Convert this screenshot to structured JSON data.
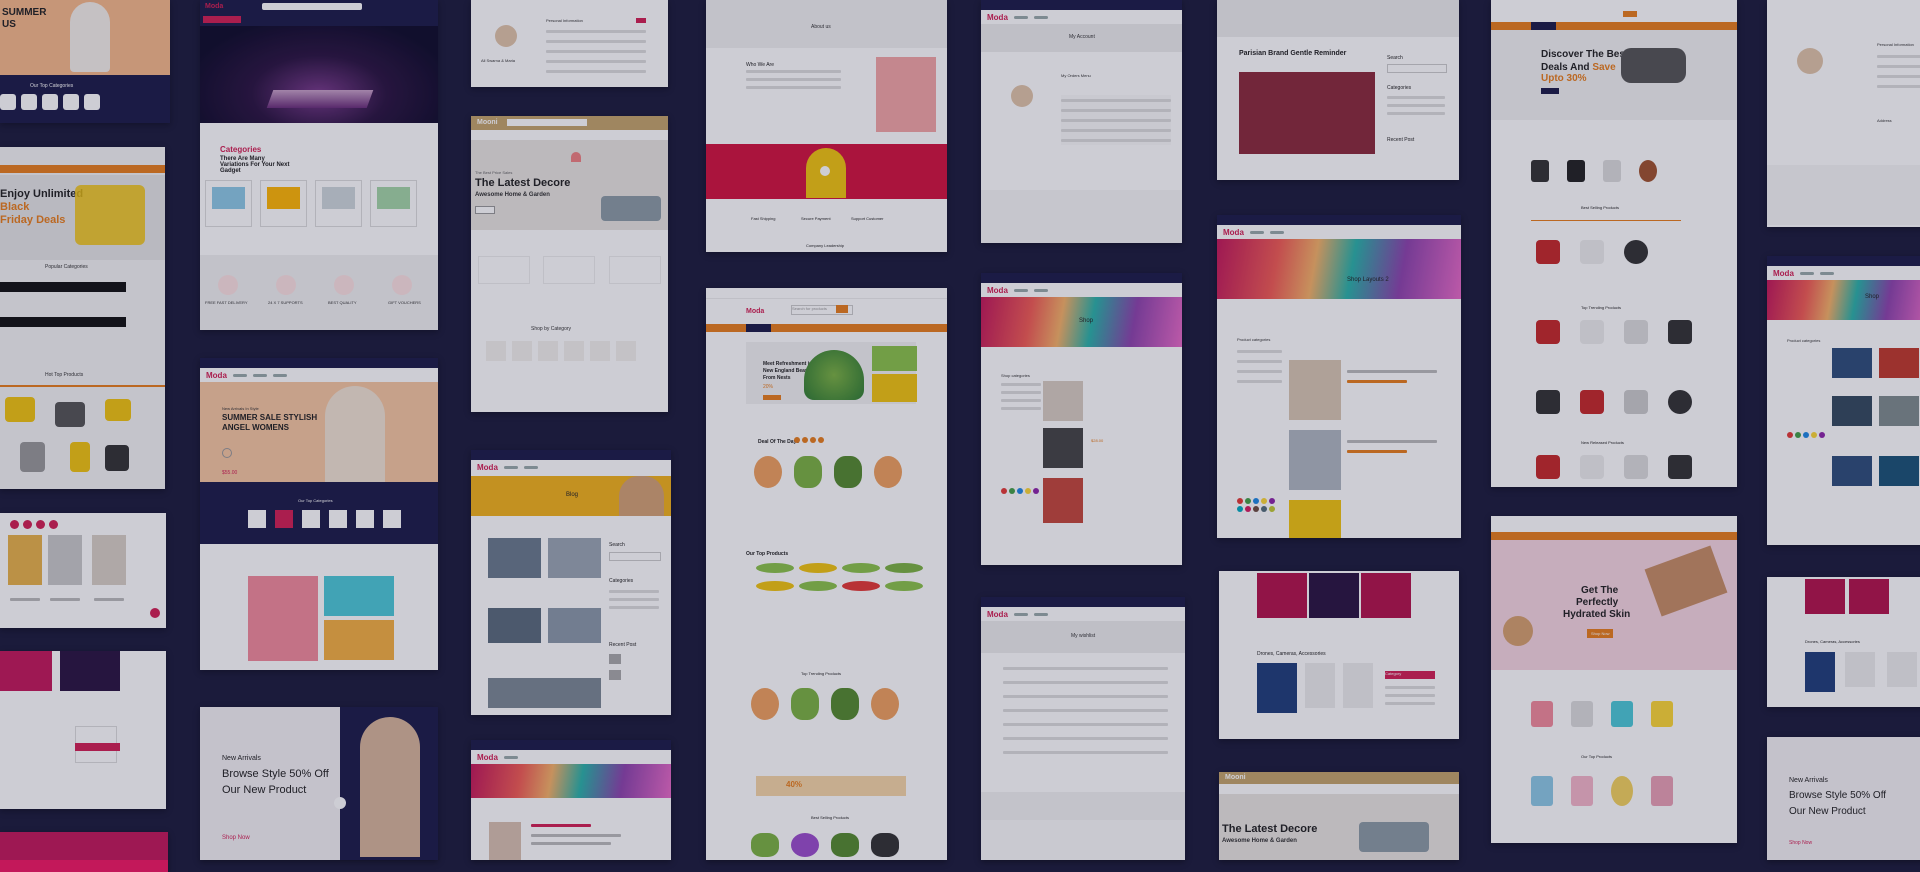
{
  "brand": "Moda",
  "cards": {
    "c1": {
      "title": "SUMMER",
      "sub": "US",
      "cat": "Our Top Categories"
    },
    "c2": {
      "promo_title": "Enjoy Unlimited",
      "promo_l2": "Black",
      "promo_l3": "Friday Deals",
      "section": "Popular Categories",
      "prod": "Hot Top Products"
    },
    "c3": {
      "cat_title": "Categories",
      "cat_sub": "There Are Many Variations For Your Next Gadget",
      "f1": "FREE FAST DELIVERY",
      "f2": "24 X 7 SUPPORTS",
      "f3": "BEST QUALITY",
      "f4": "GIFT VOUCHERS"
    },
    "c4": {
      "eyebrow": "New Arrivals In Style",
      "title_l1": "SUMMER SALE STYLISH",
      "title_l2": "ANGEL WOMENS",
      "cats": "Our Top Categories",
      "price": "$55.00"
    },
    "c5": {
      "new_arrivals": "New Arrivals",
      "title_l1": "Browse Style 50% Off",
      "title_l2": "Our New Product",
      "shop": "Shop Now"
    },
    "c6": {
      "panel_title": "Personal Information",
      "user": "All Swarna & Maria"
    },
    "c7": {
      "brand": "Mooni",
      "eyebrow": "The Best Price Sales",
      "title": "The Latest Decore",
      "sub": "Awesome Home & Garden",
      "shop": "Shop by Category"
    },
    "c8": {
      "page_title": "Blog",
      "search": "Search",
      "categories": "Categories",
      "recent": "Recent Post"
    },
    "c9": {
      "about": "About us",
      "who": "Who We Are",
      "f1": "Fast Shipping",
      "f2": "Secure Payment",
      "f3": "Support Customer",
      "team": "Company Leadership"
    },
    "c10": {
      "search_placeholder": "Search for products",
      "hero_l1": "Meet Refreshment in",
      "hero_l2": "New England Bean",
      "hero_l3": "From Nests",
      "discount": "20%",
      "deal": "Deal Of The Days",
      "top": "Our Top Products",
      "trending": "Top Trending Products",
      "banner_pct": "40%",
      "bestsellers": "Best Selling Products"
    },
    "c11": {
      "title": "My Account",
      "orders": "My Orders Menu"
    },
    "c12": {
      "title": "Shop",
      "categories": "Shop categories"
    },
    "c13": {
      "title": "My wishlist"
    },
    "c14": {
      "title": "Parisian Brand Gentle Reminder",
      "search": "Search",
      "categories": "Categories",
      "recent": "Recent Post"
    },
    "c15": {
      "title": "Shop Layouts 2",
      "cat": "Product categories"
    },
    "c16": {
      "section": "Drones, Cameras, Accessories",
      "cats": "Category"
    },
    "c17": {
      "brand": "Mooni",
      "title": "The Latest Decore",
      "sub": "Awesome Home & Garden"
    },
    "c18": {
      "title_l1": "Discover The Best",
      "title_l2a": "Deals And ",
      "title_l2b": "Save",
      "title_l3": "Upto 30%",
      "best": "Best Selling Products",
      "trending": "Top Trending Products",
      "newarr": "New Released Products"
    },
    "c19": {
      "title_l1": "Get The",
      "title_l2": "Perfectly",
      "title_l3": "Hydrated Skin",
      "btn": "Shop Now",
      "top": "Our Top Products"
    },
    "c20": {
      "panel_title": "Personal Information",
      "address": "Address"
    },
    "c21": {
      "title": "Shop",
      "cats": "Product categories"
    },
    "c22": {
      "section": "Drones, Cameras, Accessories"
    },
    "c23": {
      "new_arrivals": "New Arrivals",
      "title_l1": "Browse Style 50% Off",
      "title_l2": "Our New Product",
      "shop": "Shop Now"
    }
  },
  "colors": {
    "accent": "#d31f54",
    "orange": "#e87e1c",
    "navy": "#1c1c48",
    "background": "#1b1b3b"
  }
}
